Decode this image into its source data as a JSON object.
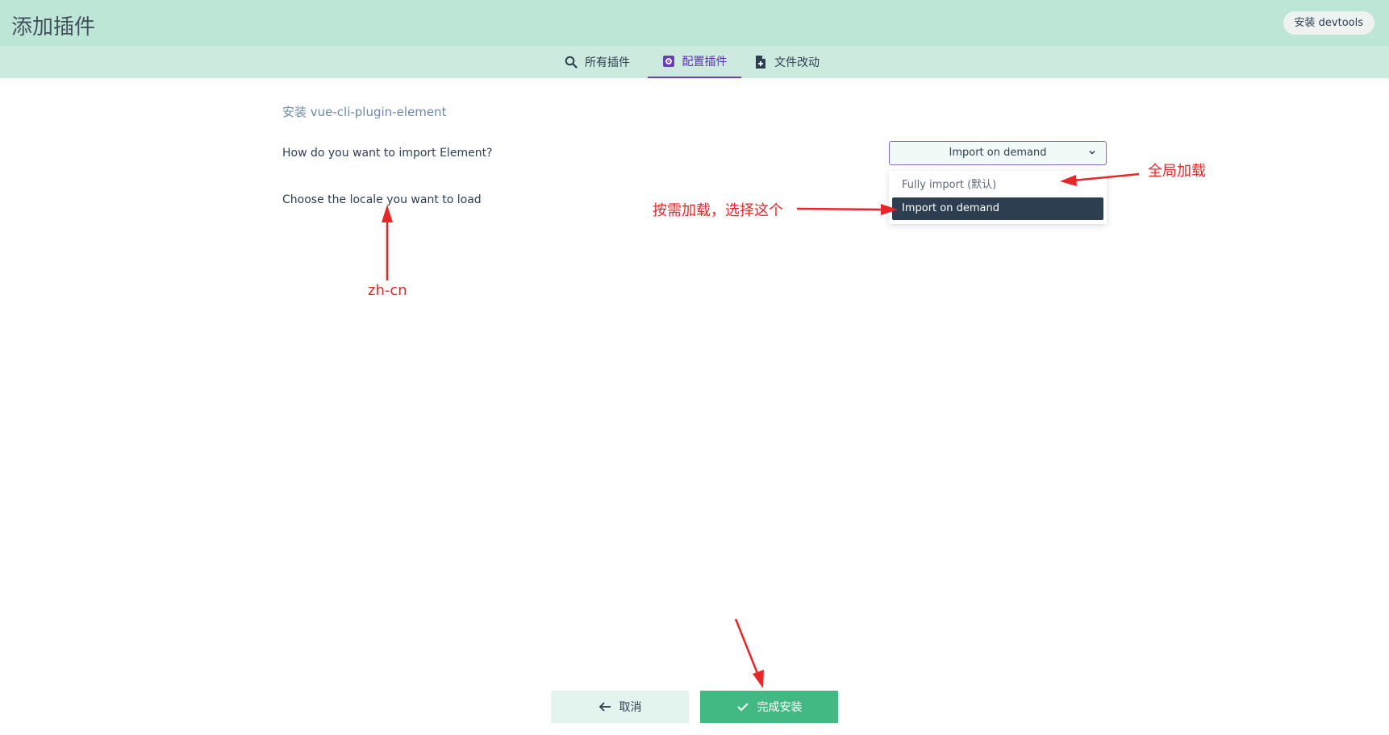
{
  "header": {
    "title": "添加插件",
    "devtools_button": "安装 devtools",
    "bg_color": "#bde6d6"
  },
  "tabs": [
    {
      "label": "所有插件",
      "icon": "search-icon",
      "active": false
    },
    {
      "label": "配置插件",
      "icon": "settings-icon",
      "active": true
    },
    {
      "label": "文件改动",
      "icon": "file-add-icon",
      "active": false
    }
  ],
  "form": {
    "title": "安装 vue-cli-plugin-element",
    "import_prompt": "How do you want to import Element?",
    "import_selected": "Import on demand",
    "import_options": [
      "Fully import (默认)",
      "Import on demand"
    ],
    "locale_prompt": "Choose the locale you want to load"
  },
  "annotations": {
    "full_load": "全局加载",
    "on_demand": "按需加载，选择这个",
    "locale": "zh-cn"
  },
  "footer": {
    "cancel_label": "取消",
    "finish_label": "完成安装"
  },
  "colors": {
    "accent": "#42b983",
    "active_tab": "#5b2fa8",
    "annotation": "#e8262a"
  }
}
